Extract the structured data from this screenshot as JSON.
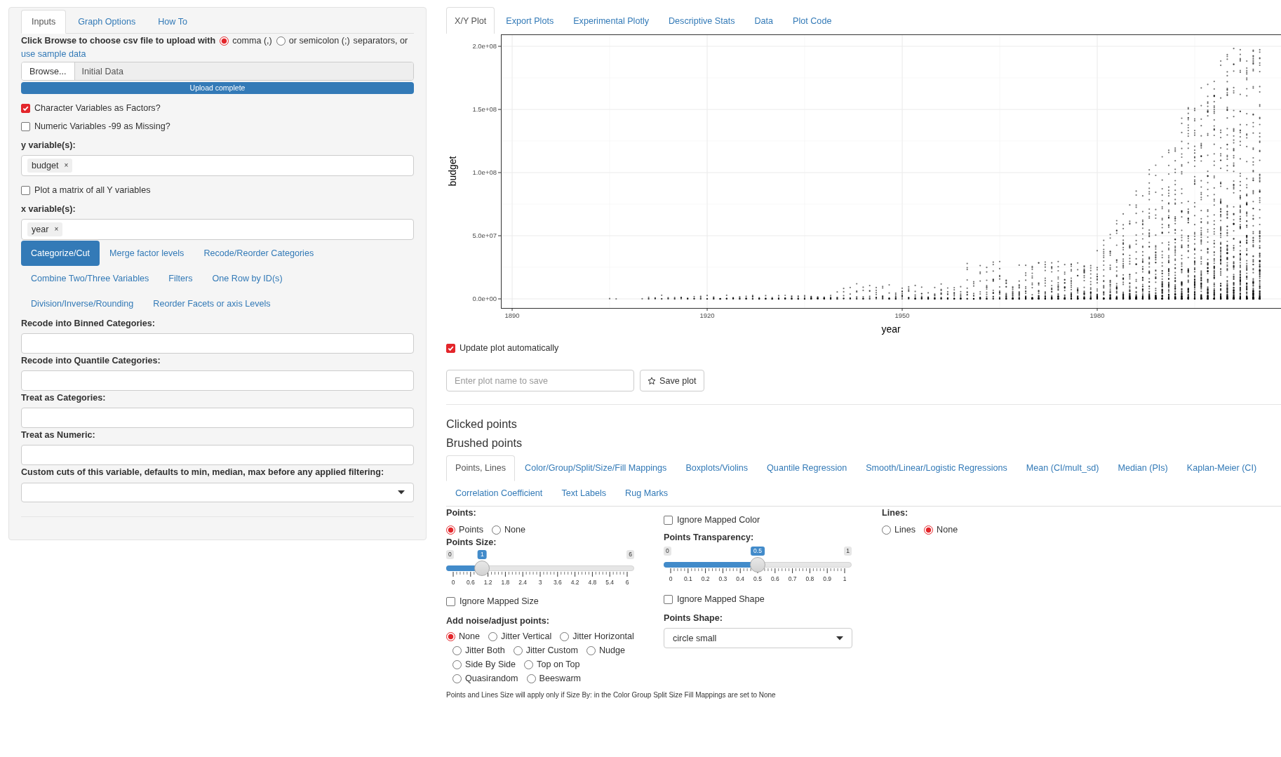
{
  "sidebar": {
    "tabs": [
      {
        "label": "Inputs",
        "selected": true
      },
      {
        "label": "Graph Options",
        "selected": false
      },
      {
        "label": "How To",
        "selected": false
      }
    ],
    "upload": {
      "prompt": "Click Browse to choose csv file to upload with",
      "separators": [
        {
          "label": "comma (,)",
          "selected": true
        },
        {
          "label": "or semicolon (;)",
          "selected": false
        }
      ],
      "suffix": "separators, or",
      "sample_link": "use sample data",
      "browse_button": "Browse...",
      "file_name": "Initial Data",
      "progress": {
        "label": "Upload complete",
        "level": 1
      }
    },
    "options": [
      {
        "label": "Character Variables as Factors?",
        "checked": true
      },
      {
        "label": "Numeric Variables -99 as Missing?",
        "checked": false
      }
    ],
    "y_variables": {
      "label": "y variable(s):",
      "tags": [
        {
          "text": "budget",
          "remove": "×"
        }
      ]
    },
    "matrix_option": {
      "label": "Plot a matrix of all Y variables",
      "checked": false
    },
    "x_variables": {
      "label": "x variable(s):",
      "tags": [
        {
          "text": "year",
          "remove": "×"
        }
      ]
    },
    "transform_tabs": [
      {
        "label": "Categorize/Cut",
        "selected": true
      },
      {
        "label": "Merge factor levels",
        "selected": false
      },
      {
        "label": "Recode/Reorder Categories",
        "selected": false
      },
      {
        "label": "Combine Two/Three Variables",
        "selected": false
      },
      {
        "label": "Filters",
        "selected": false
      },
      {
        "label": "One Row by ID(s)",
        "selected": false
      },
      {
        "label": "Division/Inverse/Rounding",
        "selected": false
      },
      {
        "label": "Reorder Facets or axis Levels",
        "selected": false
      }
    ],
    "fields": [
      {
        "label": "Recode into Binned Categories:",
        "kind": "text"
      },
      {
        "label": "Recode into Quantile Categories:",
        "kind": "text"
      },
      {
        "label": "Treat as Categories:",
        "kind": "text"
      },
      {
        "label": "Treat as Numeric:",
        "kind": "text"
      },
      {
        "label": "Custom cuts of this variable, defaults to min, median, max before any applied filtering:",
        "kind": "select"
      }
    ]
  },
  "main": {
    "tabs": [
      {
        "label": "X/Y Plot",
        "selected": true
      },
      {
        "label": "Export Plots",
        "selected": false
      },
      {
        "label": "Experimental Plotly",
        "selected": false
      },
      {
        "label": "Descriptive Stats",
        "selected": false
      },
      {
        "label": "Data",
        "selected": false
      },
      {
        "label": "Plot Code",
        "selected": false
      }
    ],
    "plot": {
      "chart_data": {
        "type": "scatter",
        "grid": true,
        "xlabel": "year",
        "ylabel": "budget",
        "xlim": [
          1888.27,
          2008.27
        ],
        "ylim": [
          -7222222,
          209444444
        ],
        "xticks": [
          1890,
          1920,
          1950,
          1980
        ],
        "yticks": [
          {
            "value": 0,
            "label": "0.0e+00"
          },
          {
            "value": 50000000,
            "label": "5.0e+07"
          },
          {
            "value": 100000000,
            "label": "1.0e+08"
          },
          {
            "value": 150000000,
            "label": "1.5e+08"
          },
          {
            "value": 200000000,
            "label": "2.0e+08"
          }
        ]
      }
    },
    "auto_update": {
      "label": "Update plot automatically",
      "checked": true
    },
    "save": {
      "placeholder": "Enter plot name to save",
      "button": "Save plot"
    },
    "clicked_points": "Clicked points",
    "brushed_points": "Brushed points",
    "option_tabs": [
      {
        "label": "Points, Lines",
        "selected": true
      },
      {
        "label": "Color/Group/Split/Size/Fill Mappings",
        "selected": false
      },
      {
        "label": "Boxplots/Violins",
        "selected": false
      },
      {
        "label": "Quantile Regression",
        "selected": false
      },
      {
        "label": "Smooth/Linear/Logistic Regressions",
        "selected": false
      },
      {
        "label": "Mean (CI/mult_sd)",
        "selected": false
      },
      {
        "label": "Median (PIs)",
        "selected": false
      },
      {
        "label": "Kaplan-Meier (CI)",
        "selected": false
      },
      {
        "label": "Correlation Coefficient",
        "selected": false
      },
      {
        "label": "Text Labels",
        "selected": false
      },
      {
        "label": "Rug Marks",
        "selected": false
      }
    ],
    "points": {
      "label": "Points:",
      "choices": [
        {
          "label": "Points",
          "selected": true
        },
        {
          "label": "None",
          "selected": false
        }
      ]
    },
    "size_slider": {
      "label": "Points Size:",
      "min_label": "0",
      "max_label": "6",
      "value_label": "1",
      "level": 0.1667,
      "ticks": [
        "0",
        "0.6",
        "1.2",
        "1.8",
        "2.4",
        "3",
        "3.6",
        "4.2",
        "4.8",
        "5.4",
        "6"
      ]
    },
    "ignore_size": {
      "label": "Ignore Mapped Size",
      "checked": false
    },
    "noise": {
      "label": "Add noise/adjust points:",
      "rows": [
        [
          {
            "label": "None",
            "selected": true
          },
          {
            "label": "Jitter Vertical",
            "selected": false
          },
          {
            "label": "Jitter Horizontal",
            "selected": false
          }
        ],
        [
          {
            "label": "Jitter Both",
            "selected": false
          },
          {
            "label": "Jitter Custom",
            "selected": false
          },
          {
            "label": "Nudge",
            "selected": false
          }
        ],
        [
          {
            "label": "Side By Side",
            "selected": false
          },
          {
            "label": "Top on Top",
            "selected": false
          }
        ],
        [
          {
            "label": "Quasirandom",
            "selected": false
          },
          {
            "label": "Beeswarm",
            "selected": false
          }
        ]
      ]
    },
    "note": "Points and Lines Size will apply only if Size By: in the Color Group Split Size Fill Mappings are set to None",
    "ignore_color": {
      "label": "Ignore Mapped Color",
      "checked": false
    },
    "transparency_slider": {
      "label": "Points Transparency:",
      "min_label": "0",
      "max_label": "1",
      "value_label": "0.5",
      "level": 0.5,
      "ticks": [
        "0",
        "0.1",
        "0.2",
        "0.3",
        "0.4",
        "0.5",
        "0.6",
        "0.7",
        "0.8",
        "0.9",
        "1"
      ]
    },
    "ignore_shape": {
      "label": "Ignore Mapped Shape",
      "checked": false
    },
    "shape": {
      "label": "Points Shape:",
      "value": "circle small"
    },
    "lines": {
      "label": "Lines:",
      "choices": [
        {
          "label": "Lines",
          "selected": false
        },
        {
          "label": "None",
          "selected": true
        }
      ]
    }
  }
}
